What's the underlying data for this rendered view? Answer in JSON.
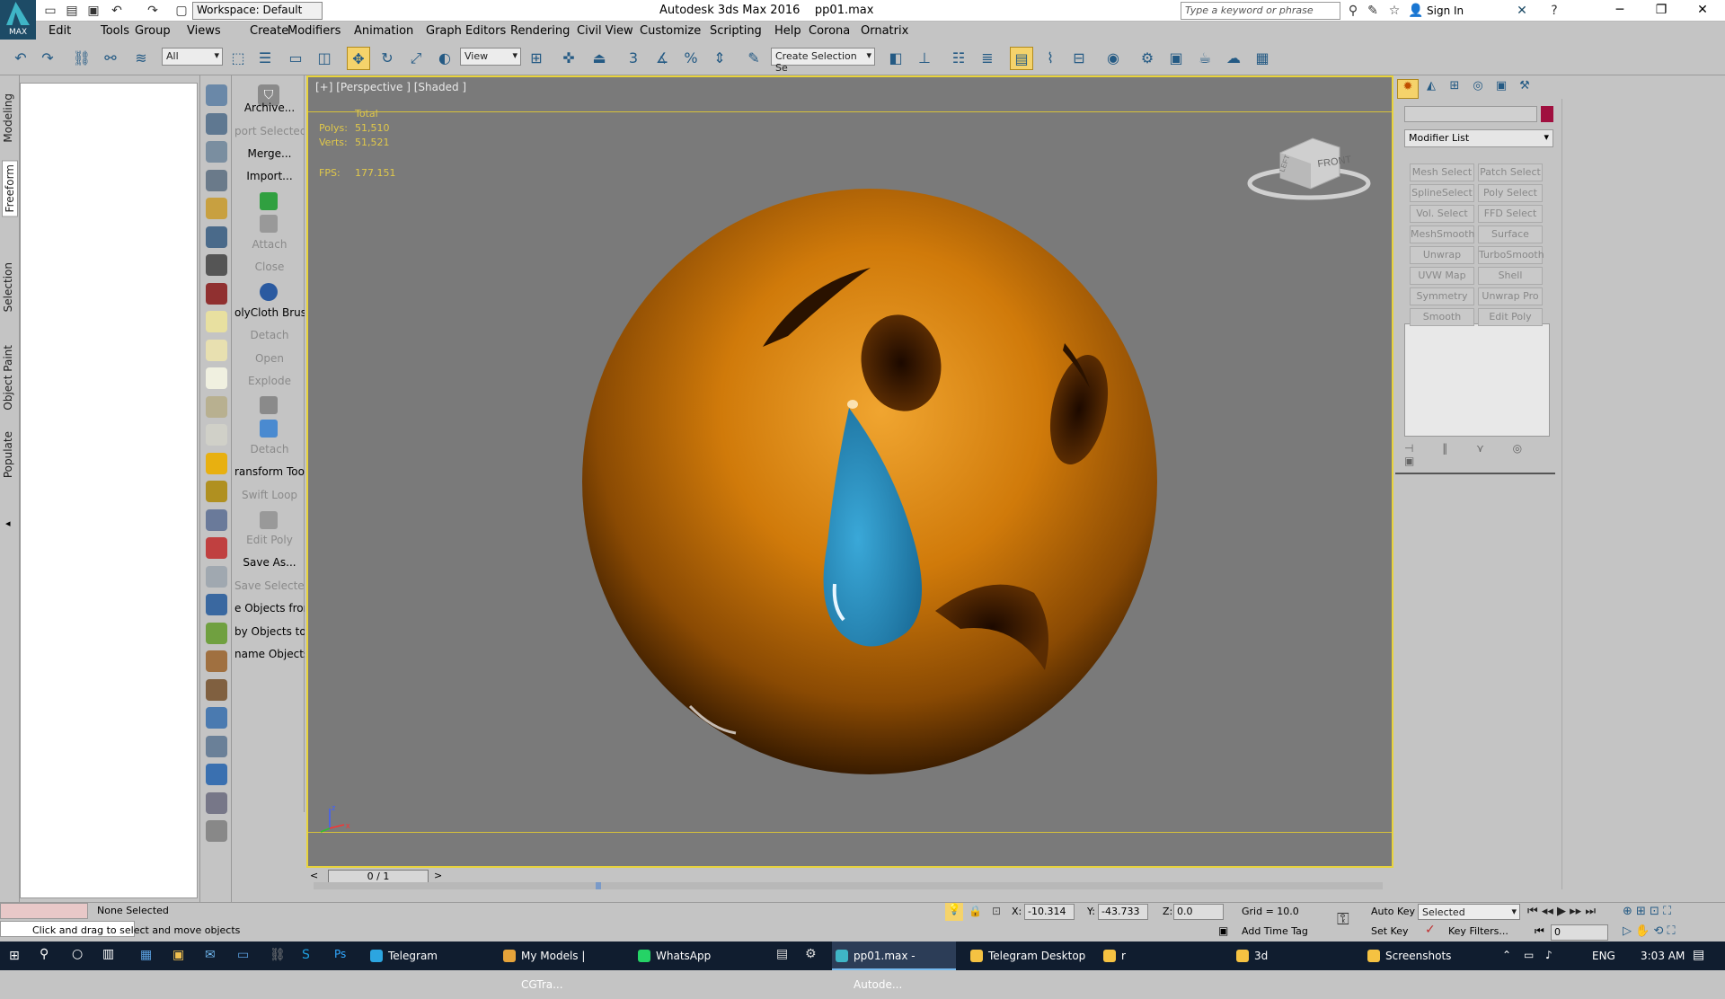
{
  "app": {
    "title": "Autodesk 3ds Max 2016",
    "file": "pp01.max",
    "logo_label": "MAX",
    "workspace": "Workspace: Default",
    "search_placeholder": "Type a keyword or phrase",
    "sign_in": "Sign In"
  },
  "menu": [
    "Edit",
    "Tools",
    "Group",
    "Views",
    "Create",
    "Modifiers",
    "Animation",
    "Graph Editors",
    "Rendering",
    "Civil View",
    "Customize",
    "Scripting",
    "Help",
    "Corona",
    "Ornatrix"
  ],
  "toolbar": {
    "filter": "All",
    "ref_coord": "View",
    "selection_set": "Create Selection Se"
  },
  "left_tabs": [
    "Modeling",
    "Freeform",
    "Selection",
    "Object Paint",
    "Populate"
  ],
  "commands": [
    {
      "label": "Archive...",
      "enabled": true
    },
    {
      "label": "port Selected",
      "enabled": false
    },
    {
      "label": "Merge...",
      "enabled": true
    },
    {
      "label": "Import...",
      "enabled": true
    },
    {
      "label": "Attach",
      "enabled": false
    },
    {
      "label": "Close",
      "enabled": false
    },
    {
      "label": "olyCloth Brush",
      "enabled": true
    },
    {
      "label": "Detach",
      "enabled": false
    },
    {
      "label": "Open",
      "enabled": false
    },
    {
      "label": "Explode",
      "enabled": false
    },
    {
      "label": "Detach",
      "enabled": false
    },
    {
      "label": "ransform Tool",
      "enabled": true
    },
    {
      "label": "Swift Loop",
      "enabled": false
    },
    {
      "label": "Edit Poly",
      "enabled": false
    },
    {
      "label": "Save As...",
      "enabled": true
    },
    {
      "label": "Save Selected",
      "enabled": false
    },
    {
      "label": "e Objects fron",
      "enabled": true
    },
    {
      "label": "by Objects to",
      "enabled": true
    },
    {
      "label": "name Objects",
      "enabled": true
    }
  ],
  "viewport": {
    "label": "[+] [Perspective ] [Shaded ]",
    "stats_header": "Total",
    "polys_label": "Polys:",
    "polys": "51,510",
    "verts_label": "Verts:",
    "verts": "51,521",
    "fps_label": "FPS:",
    "fps": "177.151",
    "viewcube_front": "FRONT",
    "viewcube_left": "LEFT",
    "axis_x": "x",
    "axis_z": "z",
    "frame": "0 / 1"
  },
  "modifier_panel": {
    "list_label": "Modifier List",
    "buttons": [
      "Mesh Select",
      "Patch Select",
      "SplineSelect",
      "Poly Select",
      "Vol. Select",
      "FFD Select",
      "MeshSmooth",
      "Surface Select",
      "Unwrap UVW",
      "TurboSmooth",
      "UVW Map",
      "Shell",
      "Symmetry",
      "Unwrap Pro",
      "Smooth",
      "Edit Poly"
    ]
  },
  "status": {
    "selected": "None Selected",
    "prompt": "Click and drag to select and move objects",
    "x_label": "X:",
    "x": "-10.314",
    "y_label": "Y:",
    "y": "-43.733",
    "z_label": "Z:",
    "z": "0.0",
    "grid": "Grid = 10.0",
    "add_time_tag": "Add Time Tag",
    "auto_key": "Auto Key",
    "set_key": "Set Key",
    "key_mode": "Selected",
    "key_filters": "Key Filters...",
    "current_frame": "0"
  },
  "taskbar": {
    "items": [
      {
        "label": "Telegram",
        "color": "#2ca5e0"
      },
      {
        "label": "My Models | CGTra...",
        "color": "#e5a33a"
      },
      {
        "label": "WhatsApp",
        "color": "#25d366"
      },
      {
        "label": "pp01.max - Autode...",
        "color": "#3fb5c6",
        "active": true
      },
      {
        "label": "Telegram Desktop",
        "color": "#f5c242"
      },
      {
        "label": "r",
        "color": "#f5c242"
      },
      {
        "label": "3d",
        "color": "#f5c242"
      },
      {
        "label": "Screenshots",
        "color": "#f5c242"
      }
    ],
    "lang": "ENG",
    "time": "3:03 AM"
  },
  "colors": {
    "accent_yellow": "#e8d33c",
    "emoji_face": "#d4800c",
    "teardrop": "#2a90c0",
    "viewport_bg": "#7a7a7a",
    "taskbar": "#101d2f"
  }
}
